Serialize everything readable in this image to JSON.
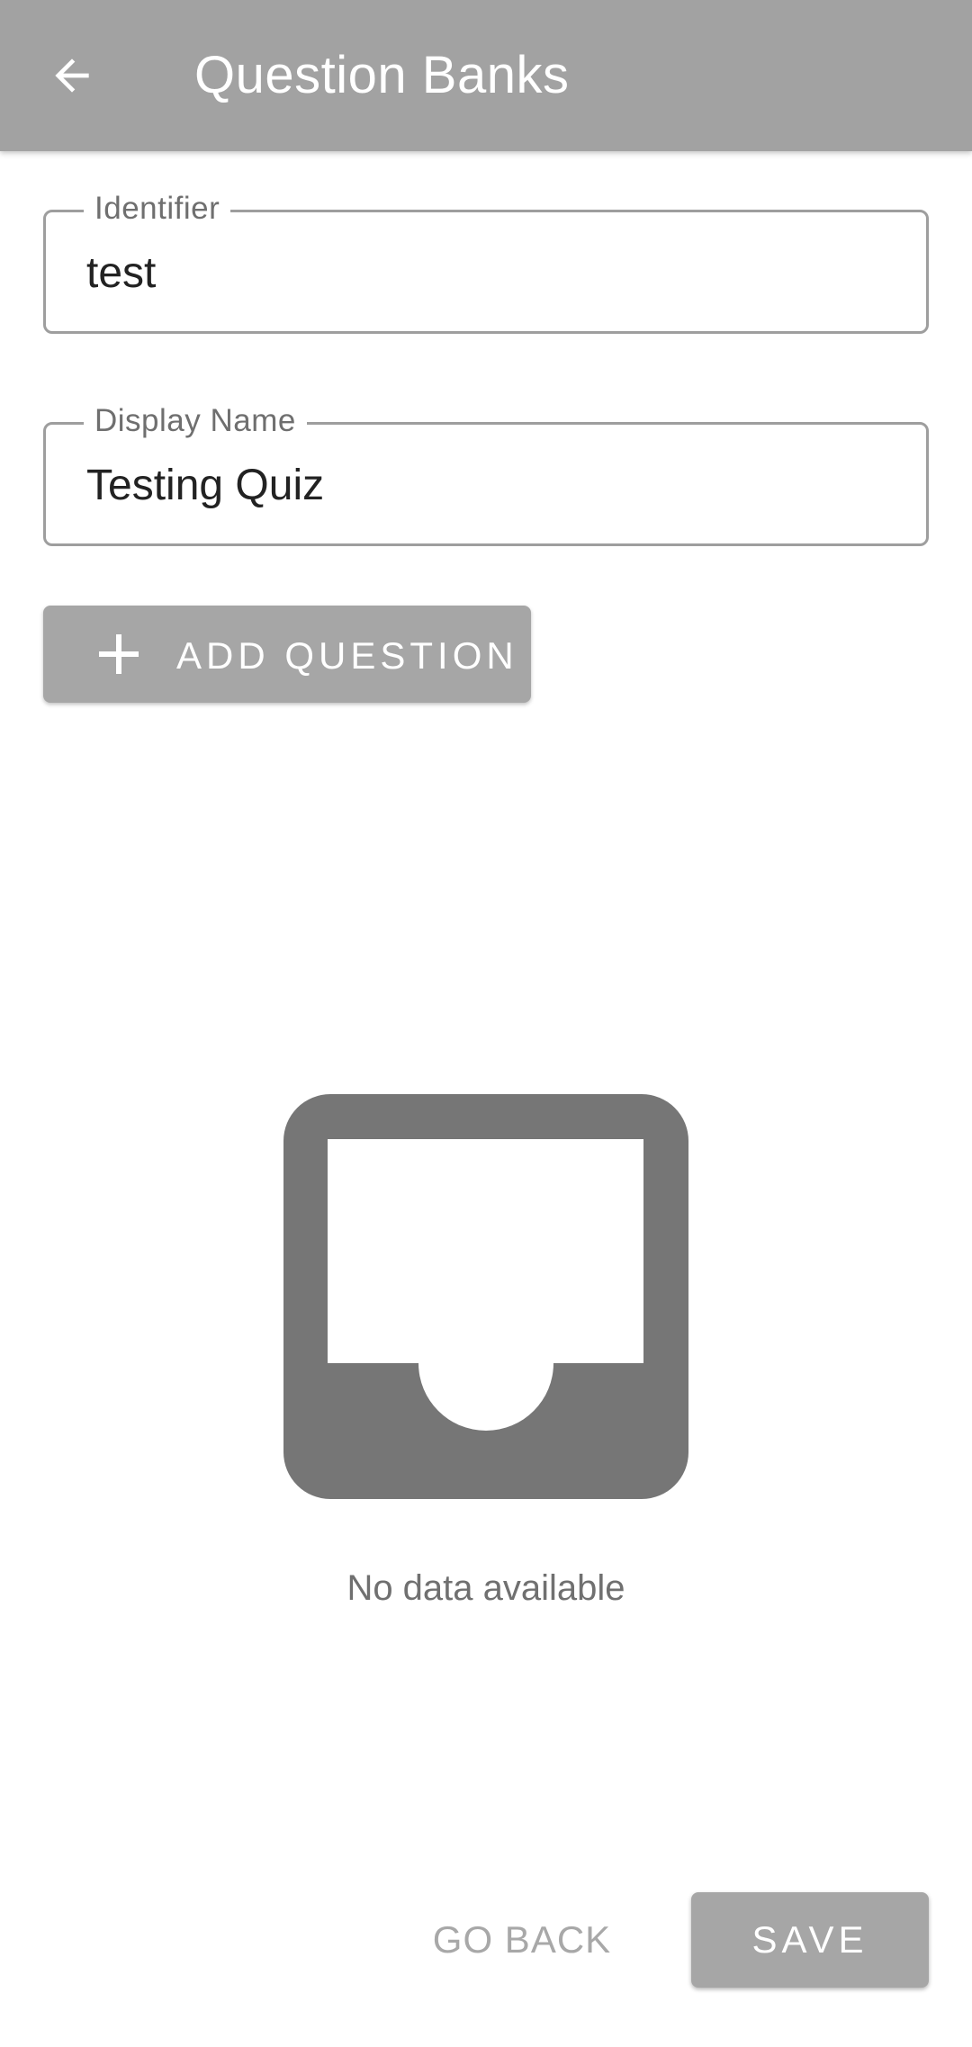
{
  "app_bar": {
    "title": "Question Banks",
    "back_icon": "arrow-left-icon",
    "color": "#a2a2a2"
  },
  "form": {
    "identifier": {
      "label": "Identifier",
      "value": "test"
    },
    "display_name": {
      "label": "Display Name",
      "value": "Testing Quiz"
    }
  },
  "add_question": {
    "icon": "plus-icon",
    "label": "ADD QUESTION"
  },
  "empty_state": {
    "icon": "inbox-icon",
    "text": "No data available"
  },
  "actions": {
    "go_back_label": "GO BACK",
    "save_label": "SAVE"
  }
}
